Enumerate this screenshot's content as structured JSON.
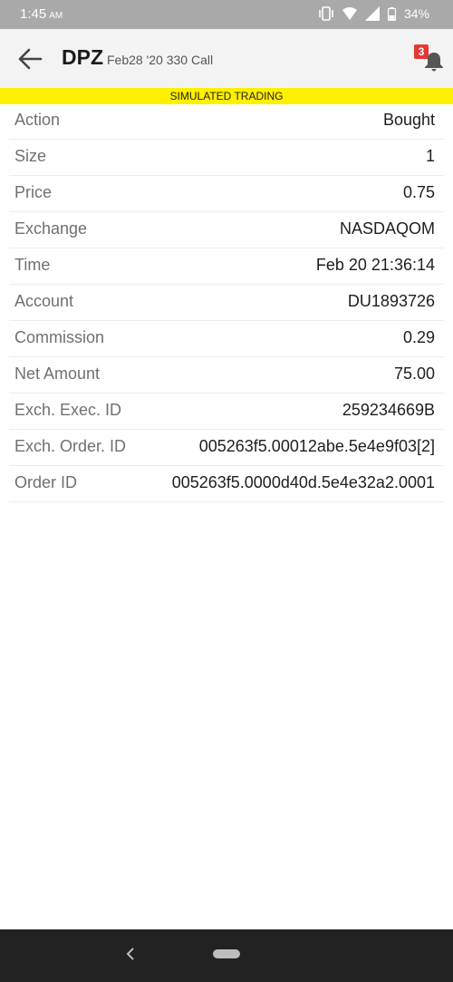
{
  "status_bar": {
    "time": "1:45",
    "ampm": "AM",
    "battery": "34%"
  },
  "header": {
    "symbol": "DPZ",
    "contract": "Feb28 '20 330 Call",
    "notification_count": "3"
  },
  "banner": {
    "text": "SIMULATED TRADING"
  },
  "details": [
    {
      "label": "Action",
      "value": "Bought"
    },
    {
      "label": "Size",
      "value": "1"
    },
    {
      "label": "Price",
      "value": "0.75"
    },
    {
      "label": "Exchange",
      "value": "NASDAQOM"
    },
    {
      "label": "Time",
      "value": "Feb 20 21:36:14"
    },
    {
      "label": "Account",
      "value": "DU1893726"
    },
    {
      "label": "Commission",
      "value": "0.29"
    },
    {
      "label": "Net Amount",
      "value": "75.00"
    },
    {
      "label": "Exch. Exec. ID",
      "value": "259234669B"
    },
    {
      "label": "Exch. Order. ID",
      "value": "005263f5.00012abe.5e4e9f03[2]"
    },
    {
      "label": "Order ID",
      "value": "005263f5.0000d40d.5e4e32a2.0001"
    }
  ],
  "colors": {
    "banner": "#ffef00",
    "badge": "#e53935",
    "status_bar": "#a9a9a9",
    "nav_bar": "#222222"
  }
}
